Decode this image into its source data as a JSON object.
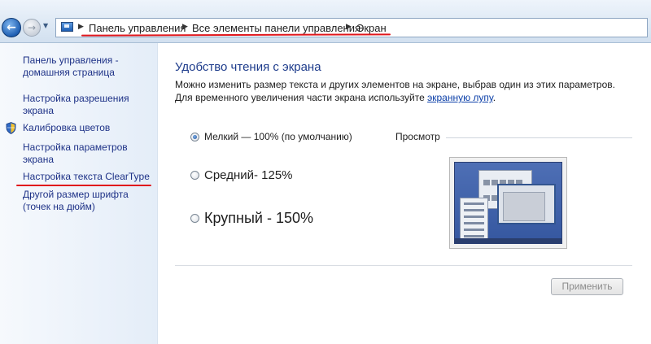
{
  "breadcrumb": {
    "items": [
      "Панель управления",
      "Все элементы панели управления",
      "Экран"
    ]
  },
  "sidebar": {
    "links": [
      "Панель управления - домашняя страница",
      "Настройка разрешения экрана",
      "Калибровка цветов",
      "Настройка параметров экрана",
      "Настройка текста ClearType",
      "Другой размер шрифта (точек на дюйм)"
    ]
  },
  "main": {
    "title": "Удобство чтения с экрана",
    "description_before": "Можно изменить размер текста и других элементов на экране, выбрав один из этих параметров. Для временного увеличения части экрана используйте ",
    "description_link": "экранную лупу",
    "description_after": ".",
    "options": [
      {
        "label": "Мелкий — 100% (по умолчанию)",
        "selected": true
      },
      {
        "label": "Средний- 125%",
        "selected": false
      },
      {
        "label": "Крупный - 150%",
        "selected": false
      }
    ],
    "preview_label": "Просмотр",
    "apply_label": "Применить"
  },
  "colors": {
    "annotation_red": "#e0161c",
    "link_blue": "#1e3287",
    "title_blue": "#1e3c8c"
  },
  "icons": [
    "back-arrow-icon",
    "forward-arrow-icon",
    "control-panel-icon",
    "shield-icon"
  ]
}
